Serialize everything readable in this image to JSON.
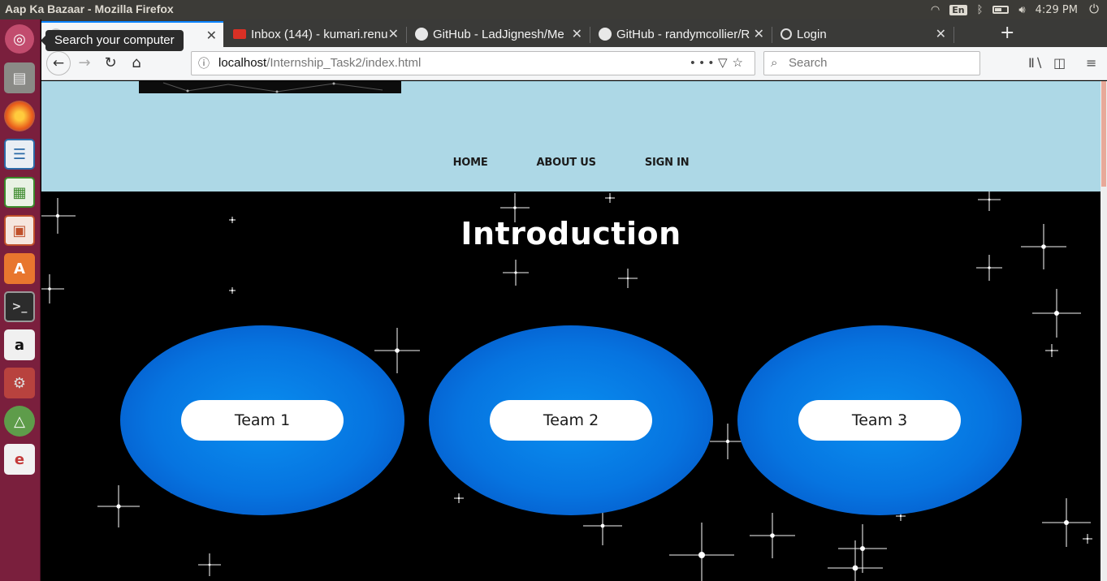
{
  "os": {
    "window_title": "Aap Ka Bazaar - Mozilla Firefox",
    "keyboard": "En",
    "time": "4:29 PM",
    "tooltip": "Search your computer",
    "launcher_icons": [
      "ubuntu-dash-icon",
      "files-icon",
      "firefox-icon",
      "writer-icon",
      "calc-icon",
      "impress-icon",
      "software-center-icon",
      "terminal-icon",
      "amazon-icon",
      "system-settings-icon",
      "android-studio-icon",
      "text-editor-icon"
    ]
  },
  "browser": {
    "tabs": [
      {
        "label": "Aap Ka Bazaar",
        "active": true
      },
      {
        "label": "Inbox (144) - kumari.renu",
        "active": false
      },
      {
        "label": "GitHub - LadJignesh/Me",
        "active": false
      },
      {
        "label": "GitHub - randymcollier/R",
        "active": false
      },
      {
        "label": "Login",
        "active": false
      }
    ],
    "url_host": "localhost",
    "url_path": "/Internship_Task2/index.html",
    "search_placeholder": "Search"
  },
  "page": {
    "colors": {
      "header_bg": "#add8e6",
      "hero_bg": "#000000",
      "team_blue": "#0674e0"
    },
    "nav": {
      "home": "HOME",
      "about": "ABOUT US",
      "signin": "SIGN IN"
    },
    "heading": "Introduction",
    "teams": [
      "Team 1",
      "Team 2",
      "Team 3"
    ]
  }
}
